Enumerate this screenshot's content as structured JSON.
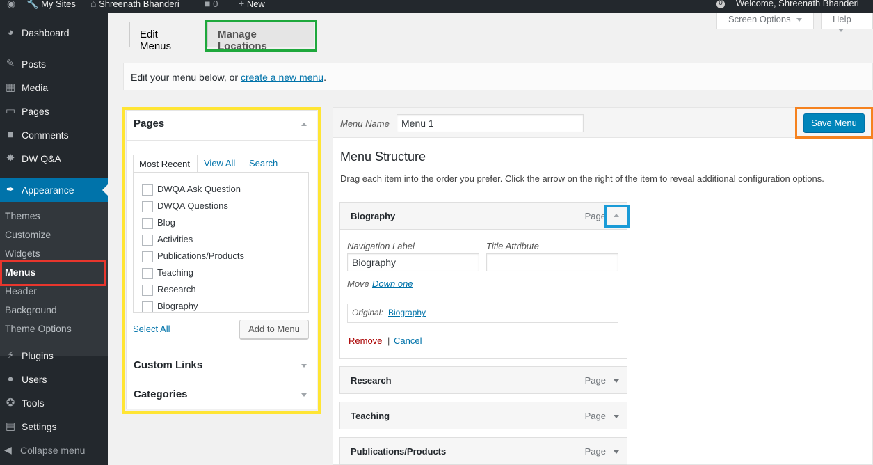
{
  "adminbar": {
    "my_sites": "My Sites",
    "site_name": "Shreenath Bhanderi",
    "comments_count": "0",
    "new": "New",
    "welcome": "Welcome, Shreenath Bhanderi",
    "notif_count": "0"
  },
  "sidebar": {
    "dashboard": "Dashboard",
    "posts": "Posts",
    "media": "Media",
    "pages": "Pages",
    "comments": "Comments",
    "dwqa": "DW Q&A",
    "appearance": "Appearance",
    "submenu": {
      "themes": "Themes",
      "customize": "Customize",
      "widgets": "Widgets",
      "menus": "Menus",
      "header": "Header",
      "background": "Background",
      "theme_options": "Theme Options"
    },
    "plugins": "Plugins",
    "users": "Users",
    "tools": "Tools",
    "settings": "Settings",
    "collapse": "Collapse menu"
  },
  "screen_meta": {
    "screen_options": "Screen Options",
    "help": "Help"
  },
  "tabs": {
    "edit_menus": "Edit Menus",
    "manage_locations": "Manage Locations"
  },
  "notice": {
    "prefix": "Edit your menu below, or ",
    "link": "create a new menu",
    "suffix": "."
  },
  "pages_box": {
    "title": "Pages",
    "tabs": [
      "Most Recent",
      "View All",
      "Search"
    ],
    "items": [
      "DWQA Ask Question",
      "DWQA Questions",
      "Blog",
      "Activities",
      "Publications/Products",
      "Teaching",
      "Research",
      "Biography"
    ],
    "select_all": "Select All",
    "add_to_menu": "Add to Menu"
  },
  "custom_links": {
    "title": "Custom Links"
  },
  "categories": {
    "title": "Categories"
  },
  "menu_editor": {
    "menu_name_label": "Menu Name",
    "menu_name_value": "Menu 1",
    "save_button": "Save Menu",
    "structure_title": "Menu Structure",
    "structure_desc": "Drag each item into the order you prefer. Click the arrow on the right of the item to reveal additional configuration options.",
    "open_item": {
      "title": "Biography",
      "type": "Page",
      "nav_label_label": "Navigation Label",
      "nav_label_value": "Biography",
      "title_attr_label": "Title Attribute",
      "title_attr_value": "",
      "move_label": "Move",
      "move_link": "Down one",
      "original_label": "Original:",
      "original_link": "Biography",
      "remove": "Remove",
      "separator": "|",
      "cancel": "Cancel"
    },
    "items": [
      {
        "title": "Research",
        "type": "Page"
      },
      {
        "title": "Teaching",
        "type": "Page"
      },
      {
        "title": "Publications/Products",
        "type": "Page"
      }
    ]
  },
  "colors": {
    "highlight_yellow": "#ffe534",
    "highlight_green": "#1ea83c",
    "highlight_orange": "#f5821f",
    "highlight_blue": "#1a9bd7",
    "highlight_red": "#e8362d",
    "wp_blue": "#0073aa",
    "sidebar_bg": "#23282d"
  }
}
